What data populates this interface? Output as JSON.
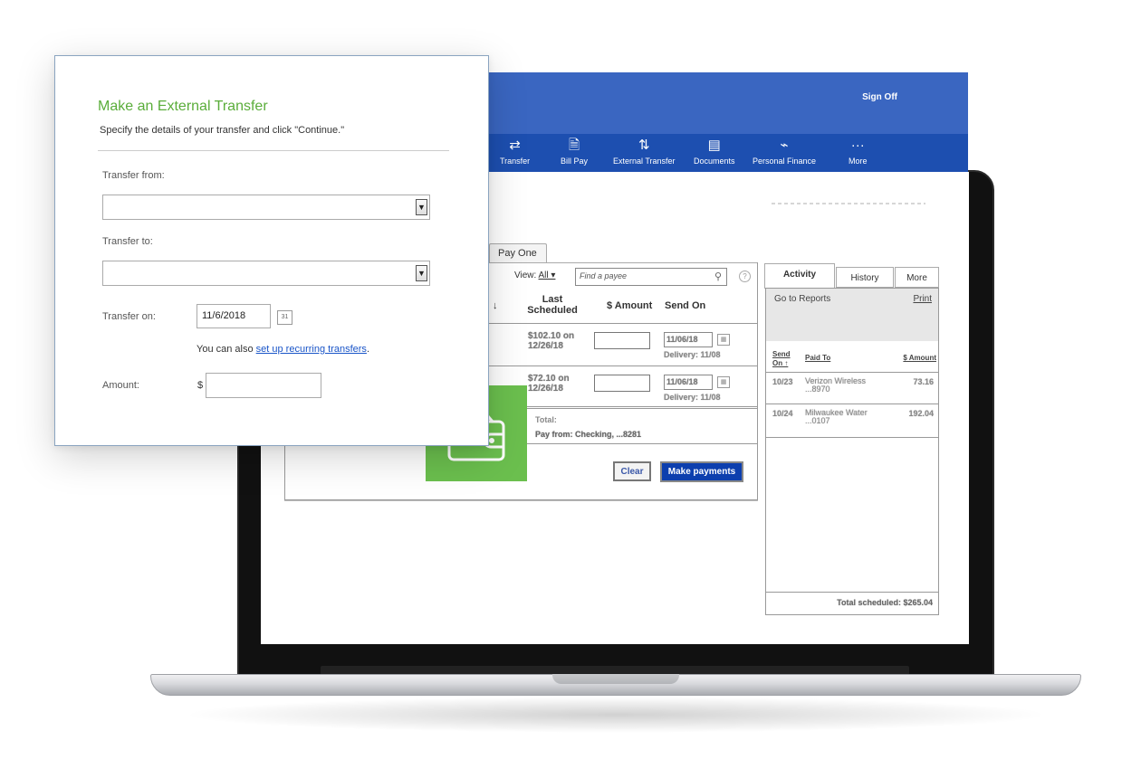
{
  "header": {
    "sign_off": "Sign Off",
    "nav": [
      {
        "label": "Transfer",
        "icon": "⇄"
      },
      {
        "label": "Bill Pay",
        "icon": "🗎"
      },
      {
        "label": "External Transfer",
        "icon": "⇅"
      },
      {
        "label": "Documents",
        "icon": "▤"
      },
      {
        "label": "Personal Finance",
        "icon": "⌁"
      },
      {
        "label": "More",
        "icon": "···"
      }
    ]
  },
  "pay": {
    "tab_label": "Pay One",
    "view_label": "View:",
    "view_value": "All ▾",
    "find_placeholder": "Find a payee",
    "help": "?",
    "sort_arrow": "↓",
    "col_last": "Last Scheduled",
    "col_amount": "$ Amount",
    "col_send": "Send On",
    "rows": [
      {
        "last": "$102.10 on 12/26/18",
        "send_on": "11/06/18",
        "delivery": "Delivery: 11/08"
      },
      {
        "last": "$72.10 on 12/26/18",
        "send_on": "11/06/18",
        "delivery": "Delivery: 11/08"
      }
    ],
    "total_label": "Total:",
    "pay_from": "Pay from: Checking, ...8281",
    "clear_label": "Clear",
    "make_payments_label": "Make payments"
  },
  "activity": {
    "tabs": [
      "Activity",
      "History",
      "More"
    ],
    "go_to_reports": "Go to Reports",
    "print": "Print",
    "col_send_on": "Send On ↑",
    "col_paid_to": "Paid To",
    "col_amount": "$ Amount",
    "rows": [
      {
        "date": "10/23",
        "payee": "Verizon Wireless ...8970",
        "amount": "73.16"
      },
      {
        "date": "10/24",
        "payee": "Milwaukee Water ...0107",
        "amount": "192.04"
      }
    ],
    "total_scheduled": "Total scheduled: $265.04"
  },
  "modal": {
    "title": "Make an External Transfer",
    "subtitle": "Specify the details of your transfer and click \"Continue.\"",
    "transfer_from_label": "Transfer from:",
    "transfer_to_label": "Transfer to:",
    "transfer_on_label": "Transfer on:",
    "transfer_on_value": "11/6/2018",
    "calendar_glyph": "31",
    "recurring_prefix": "You can also ",
    "recurring_link": "set up recurring transfers",
    "recurring_suffix": ".",
    "amount_label": "Amount:",
    "currency": "$"
  },
  "colors": {
    "header_blue": "#3a66c1",
    "nav_blue": "#1d4fb0",
    "brand_green": "#6bbf4e",
    "title_green": "#5aad3a",
    "button_blue": "#0d3fae"
  }
}
